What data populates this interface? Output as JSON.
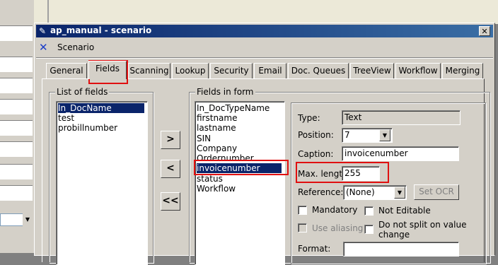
{
  "window": {
    "title": "ap_manual - scenario",
    "close_glyph": "✕"
  },
  "toolbar": {
    "icon": "scenario-icon",
    "label": "Scenario"
  },
  "tabs": [
    "General",
    "Fields",
    "Scanning",
    "Lookup",
    "Security",
    "Email",
    "Doc. Queues",
    "TreeView",
    "Workflow",
    "Merging"
  ],
  "active_tab": "Fields",
  "list_of_fields": {
    "title": "List of fields",
    "items": [
      "In_DocName",
      "test",
      "probillnumber"
    ],
    "selected": "In_DocName"
  },
  "move_buttons": {
    "add": ">",
    "remove": "<",
    "remove_all": "<<"
  },
  "fields_in_form": {
    "title": "Fields in form",
    "items": [
      "In_DocTypeName",
      "firstname",
      "lastname",
      "SIN",
      "Company",
      "Ordernumber",
      "invoicenumber",
      "status",
      "Workflow"
    ],
    "selected": "invoicenumber"
  },
  "properties": {
    "type_label": "Type:",
    "type_value": "Text",
    "position_label": "Position:",
    "position_value": "7",
    "caption_label": "Caption:",
    "caption_value": "invoicenumber",
    "maxlen_label": "Max. length:",
    "maxlen_value": "255",
    "reference_label": "Reference:",
    "reference_value": "(None)",
    "set_ocr_label": "Set OCR",
    "mandatory_label": "Mandatory",
    "not_editable_label": "Not Editable",
    "use_aliasing_label": "Use aliasing",
    "no_split_label_line1": "Do not split on value",
    "no_split_label_line2": "change",
    "format_label": "Format:"
  },
  "colors": {
    "highlight": "#e01010",
    "title_bar": "#0a246a",
    "selection": "#0a246a"
  }
}
